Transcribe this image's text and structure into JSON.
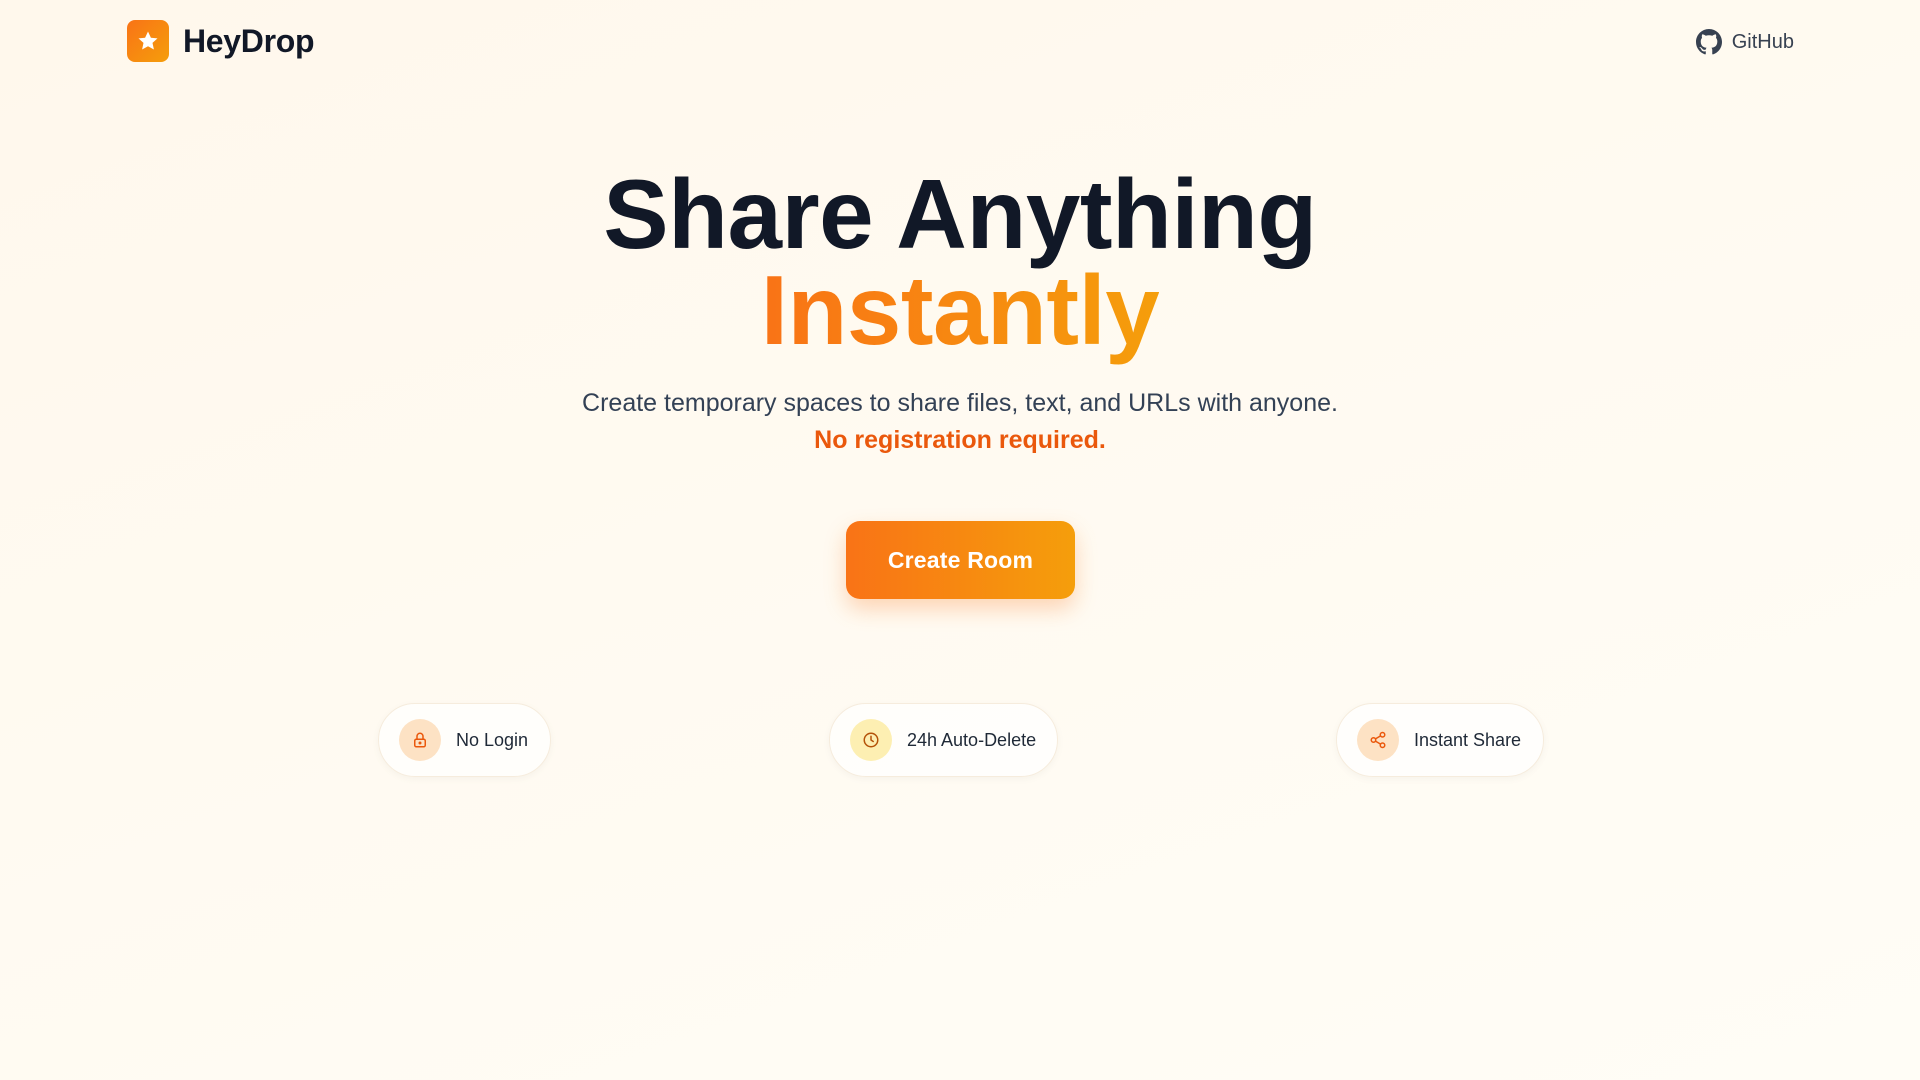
{
  "header": {
    "brand_name": "HeyDrop",
    "logo_icon": "star-icon",
    "github_label": "GitHub",
    "github_icon": "github-icon"
  },
  "hero": {
    "title_line1": "Share Anything",
    "title_line2": "Instantly",
    "subtitle": "Create temporary spaces to share files, text, and URLs with anyone.",
    "subtitle_strong": "No registration required.",
    "cta_label": "Create Room"
  },
  "features": [
    {
      "label": "No Login",
      "icon": "lock-icon"
    },
    {
      "label": "24h Auto-Delete",
      "icon": "clock-icon"
    },
    {
      "label": "Instant Share",
      "icon": "share-icon"
    }
  ],
  "colors": {
    "accent": "#f97316",
    "accent_end": "#f59e0b",
    "highlight_text": "#ea580c",
    "heading": "#111827"
  }
}
